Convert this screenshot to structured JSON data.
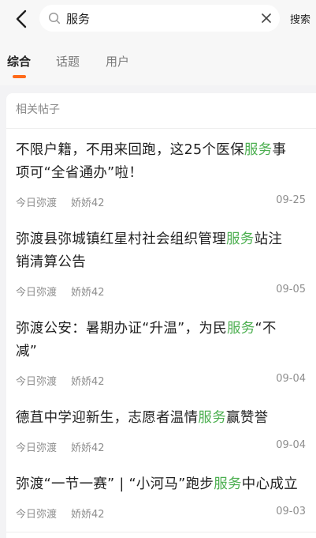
{
  "search": {
    "value": "服务",
    "placeholder": "",
    "submit_label": "搜索"
  },
  "icons": {
    "back": "chevron-left-icon",
    "search": "search-icon",
    "clear": "close-icon"
  },
  "tabs": [
    {
      "label": "综合",
      "active": true
    },
    {
      "label": "话题",
      "active": false
    },
    {
      "label": "用户",
      "active": false
    }
  ],
  "colors": {
    "accent": "#ff6a1a",
    "highlight": "#4caf50"
  },
  "section": {
    "title": "相关帖子"
  },
  "posts": [
    {
      "title_lines": [
        [
          {
            "t": "不限户籍，不用来回跑，这25个医保"
          },
          {
            "t": "服务",
            "hl": true
          },
          {
            "t": "事"
          }
        ],
        [
          {
            "t": "项可“全省通办”啦！"
          }
        ]
      ],
      "source": "今日弥渡",
      "author": "娇娇42",
      "date": "09-25"
    },
    {
      "title_lines": [
        [
          {
            "t": "弥渡县弥城镇红星村社会组织管理"
          },
          {
            "t": "服务",
            "hl": true
          },
          {
            "t": "站注"
          }
        ],
        [
          {
            "t": "销清算公告"
          }
        ]
      ],
      "source": "今日弥渡",
      "author": "娇娇42",
      "date": "09-05"
    },
    {
      "title_lines": [
        [
          {
            "t": "弥渡公安：暑期办证“升温”，为民"
          },
          {
            "t": "服务",
            "hl": true
          },
          {
            "t": "“不"
          }
        ],
        [
          {
            "t": "减”"
          }
        ]
      ],
      "source": "今日弥渡",
      "author": "娇娇42",
      "date": "09-04"
    },
    {
      "title_lines": [
        [
          {
            "t": "德苴中学迎新生，志愿者温情"
          },
          {
            "t": "服务",
            "hl": true
          },
          {
            "t": "赢赞誉"
          }
        ]
      ],
      "source": "今日弥渡",
      "author": "娇娇42",
      "date": "09-04"
    },
    {
      "title_lines": [
        [
          {
            "t": "弥渡“一节一赛” | “小河马”跑步"
          },
          {
            "t": "服务",
            "hl": true
          },
          {
            "t": "中心成立"
          }
        ]
      ],
      "source": "今日弥渡",
      "author": "娇娇42",
      "date": "09-03"
    }
  ]
}
